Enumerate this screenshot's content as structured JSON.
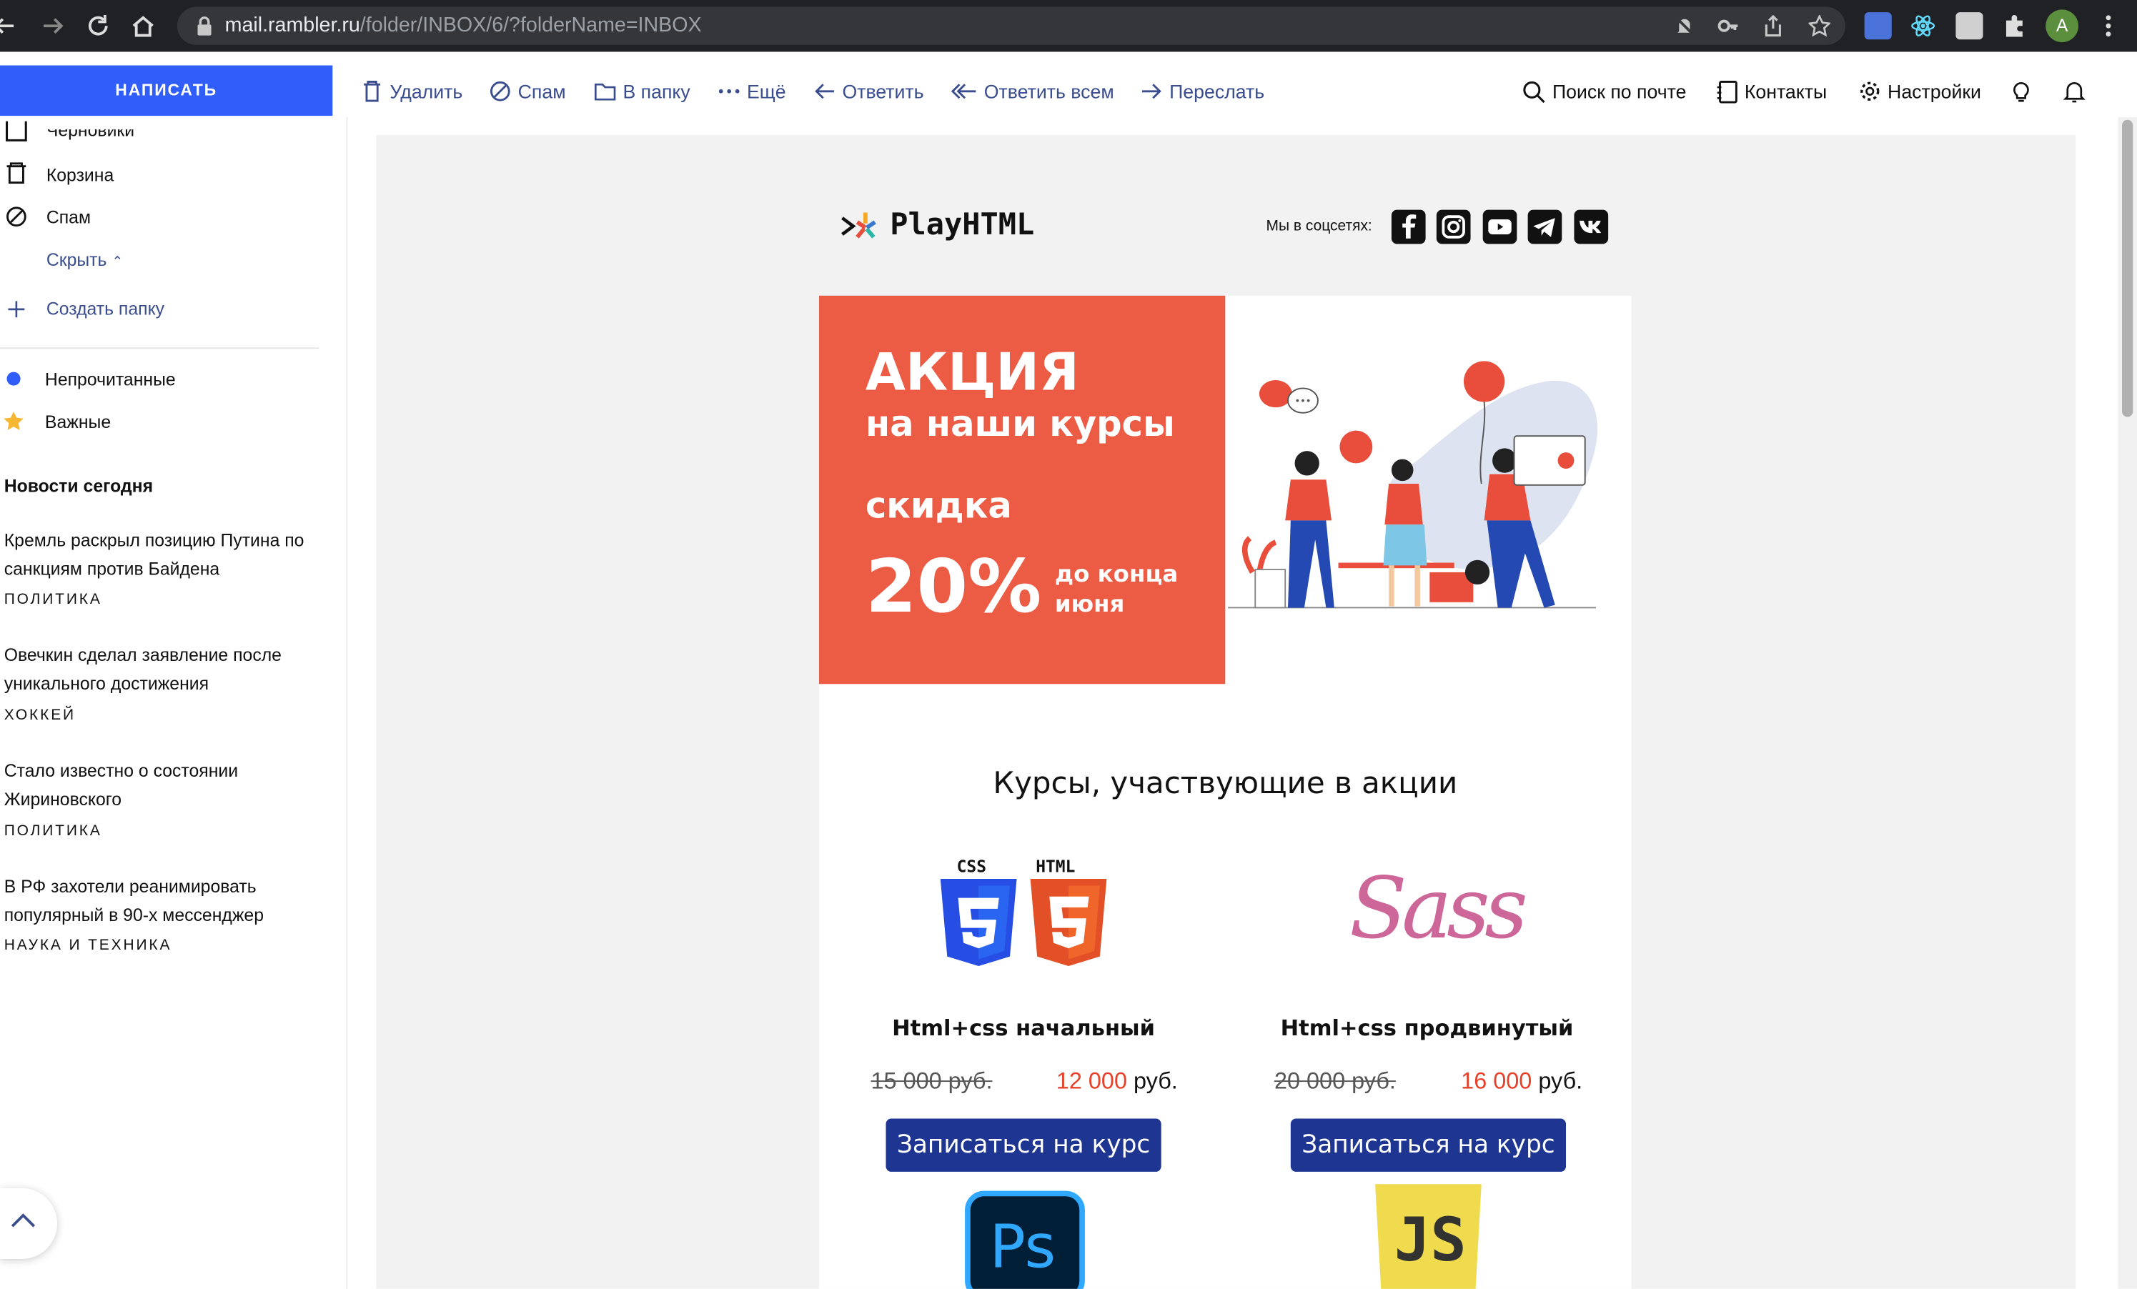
{
  "browser": {
    "url_host": "mail.rambler.ru",
    "url_path": "/folder/INBOX/6/?folderName=INBOX",
    "avatar_letter": "A"
  },
  "toolbar": {
    "compose": "НАПИСАТЬ",
    "delete": "Удалить",
    "spam": "Спам",
    "to_folder": "В папку",
    "more": "Ещё",
    "reply": "Ответить",
    "reply_all": "Ответить всем",
    "forward": "Переслать",
    "search": "Поиск по почте",
    "contacts": "Контакты",
    "settings": "Настройки"
  },
  "sidebar": {
    "drafts": "Черновики",
    "trash": "Корзина",
    "spam": "Спам",
    "hide": "Скрыть",
    "create_folder": "Создать папку",
    "unread": "Непрочитанные",
    "important": "Важные",
    "news_heading": "Новости сегодня",
    "news": [
      {
        "title": "Кремль раскрыл позицию Путина по санкциям против Байдена",
        "category": "ПОЛИТИКА"
      },
      {
        "title": "Овечкин сделал заявление после уникального достижения",
        "category": "ХОККЕЙ"
      },
      {
        "title": "Стало известно о состоянии Жириновского",
        "category": "ПОЛИТИКА"
      },
      {
        "title": "В РФ захотели реанимировать популярный в 90-х мессенджер",
        "category": "НАУКА И ТЕХНИКА"
      }
    ]
  },
  "email": {
    "brand": "PlayHTML",
    "social_label": "Мы в соцсетях:",
    "promo": {
      "line1": "АКЦИЯ",
      "line2": "на наши курсы",
      "line3": "скидка",
      "percent": "20%",
      "until1": "до конца",
      "until2": "июня"
    },
    "courses_title": "Курсы, участвующие в акции",
    "courses": [
      {
        "name": "Html+css начальный",
        "old_price": "15 000 руб.",
        "new_price": "12 000",
        "currency": " руб.",
        "button": "Записаться на курс"
      },
      {
        "name": "Html+css продвинутый",
        "old_price": "20 000 руб.",
        "new_price": "16 000",
        "currency": " руб.",
        "button": "Записаться на курс"
      }
    ],
    "logo_labels": {
      "css": "CSS",
      "html": "HTML",
      "sass": "Sass",
      "ps": "Ps",
      "js": "JS"
    }
  },
  "colors": {
    "accent": "#315efb",
    "promo": "#ec5b43",
    "button": "#1e3592",
    "price": "#e8412a"
  }
}
